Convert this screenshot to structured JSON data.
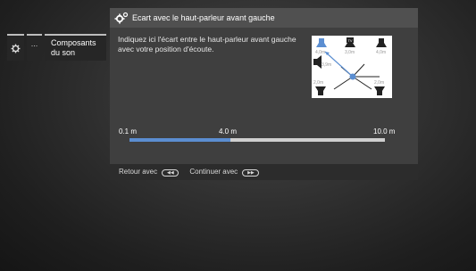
{
  "breadcrumb": {
    "items": [
      {
        "icon": "gear-icon"
      },
      {
        "label": "..."
      },
      {
        "label": "Composants du son"
      }
    ]
  },
  "dialog": {
    "icon": "speaker-settings-icon",
    "title": "Ecart avec le haut-parleur avant gauche",
    "description": "Indiquez ici l'écart entre le haut-parleur avant gauche avec votre position d'écoute.",
    "diagram": {
      "tv_label": "TV",
      "distances": {
        "front_left": "4,0m",
        "center": "3,0m",
        "front_right": "4,0m",
        "side_left": "3,9m",
        "rear_left": "2,0m",
        "rear_right": "2,0m"
      },
      "colors": {
        "highlight": "#5b8ed1",
        "speaker": "#222222"
      }
    },
    "slider": {
      "min_label": "0.1 m",
      "current_label": "4.0 m",
      "max_label": "10.0 m",
      "min": 0.1,
      "max": 10.0,
      "value": 4.0
    },
    "footer": {
      "back_label": "Retour avec",
      "back_icon": "rewind-icon",
      "continue_label": "Continuer avec",
      "continue_icon": "fast-forward-icon"
    }
  }
}
